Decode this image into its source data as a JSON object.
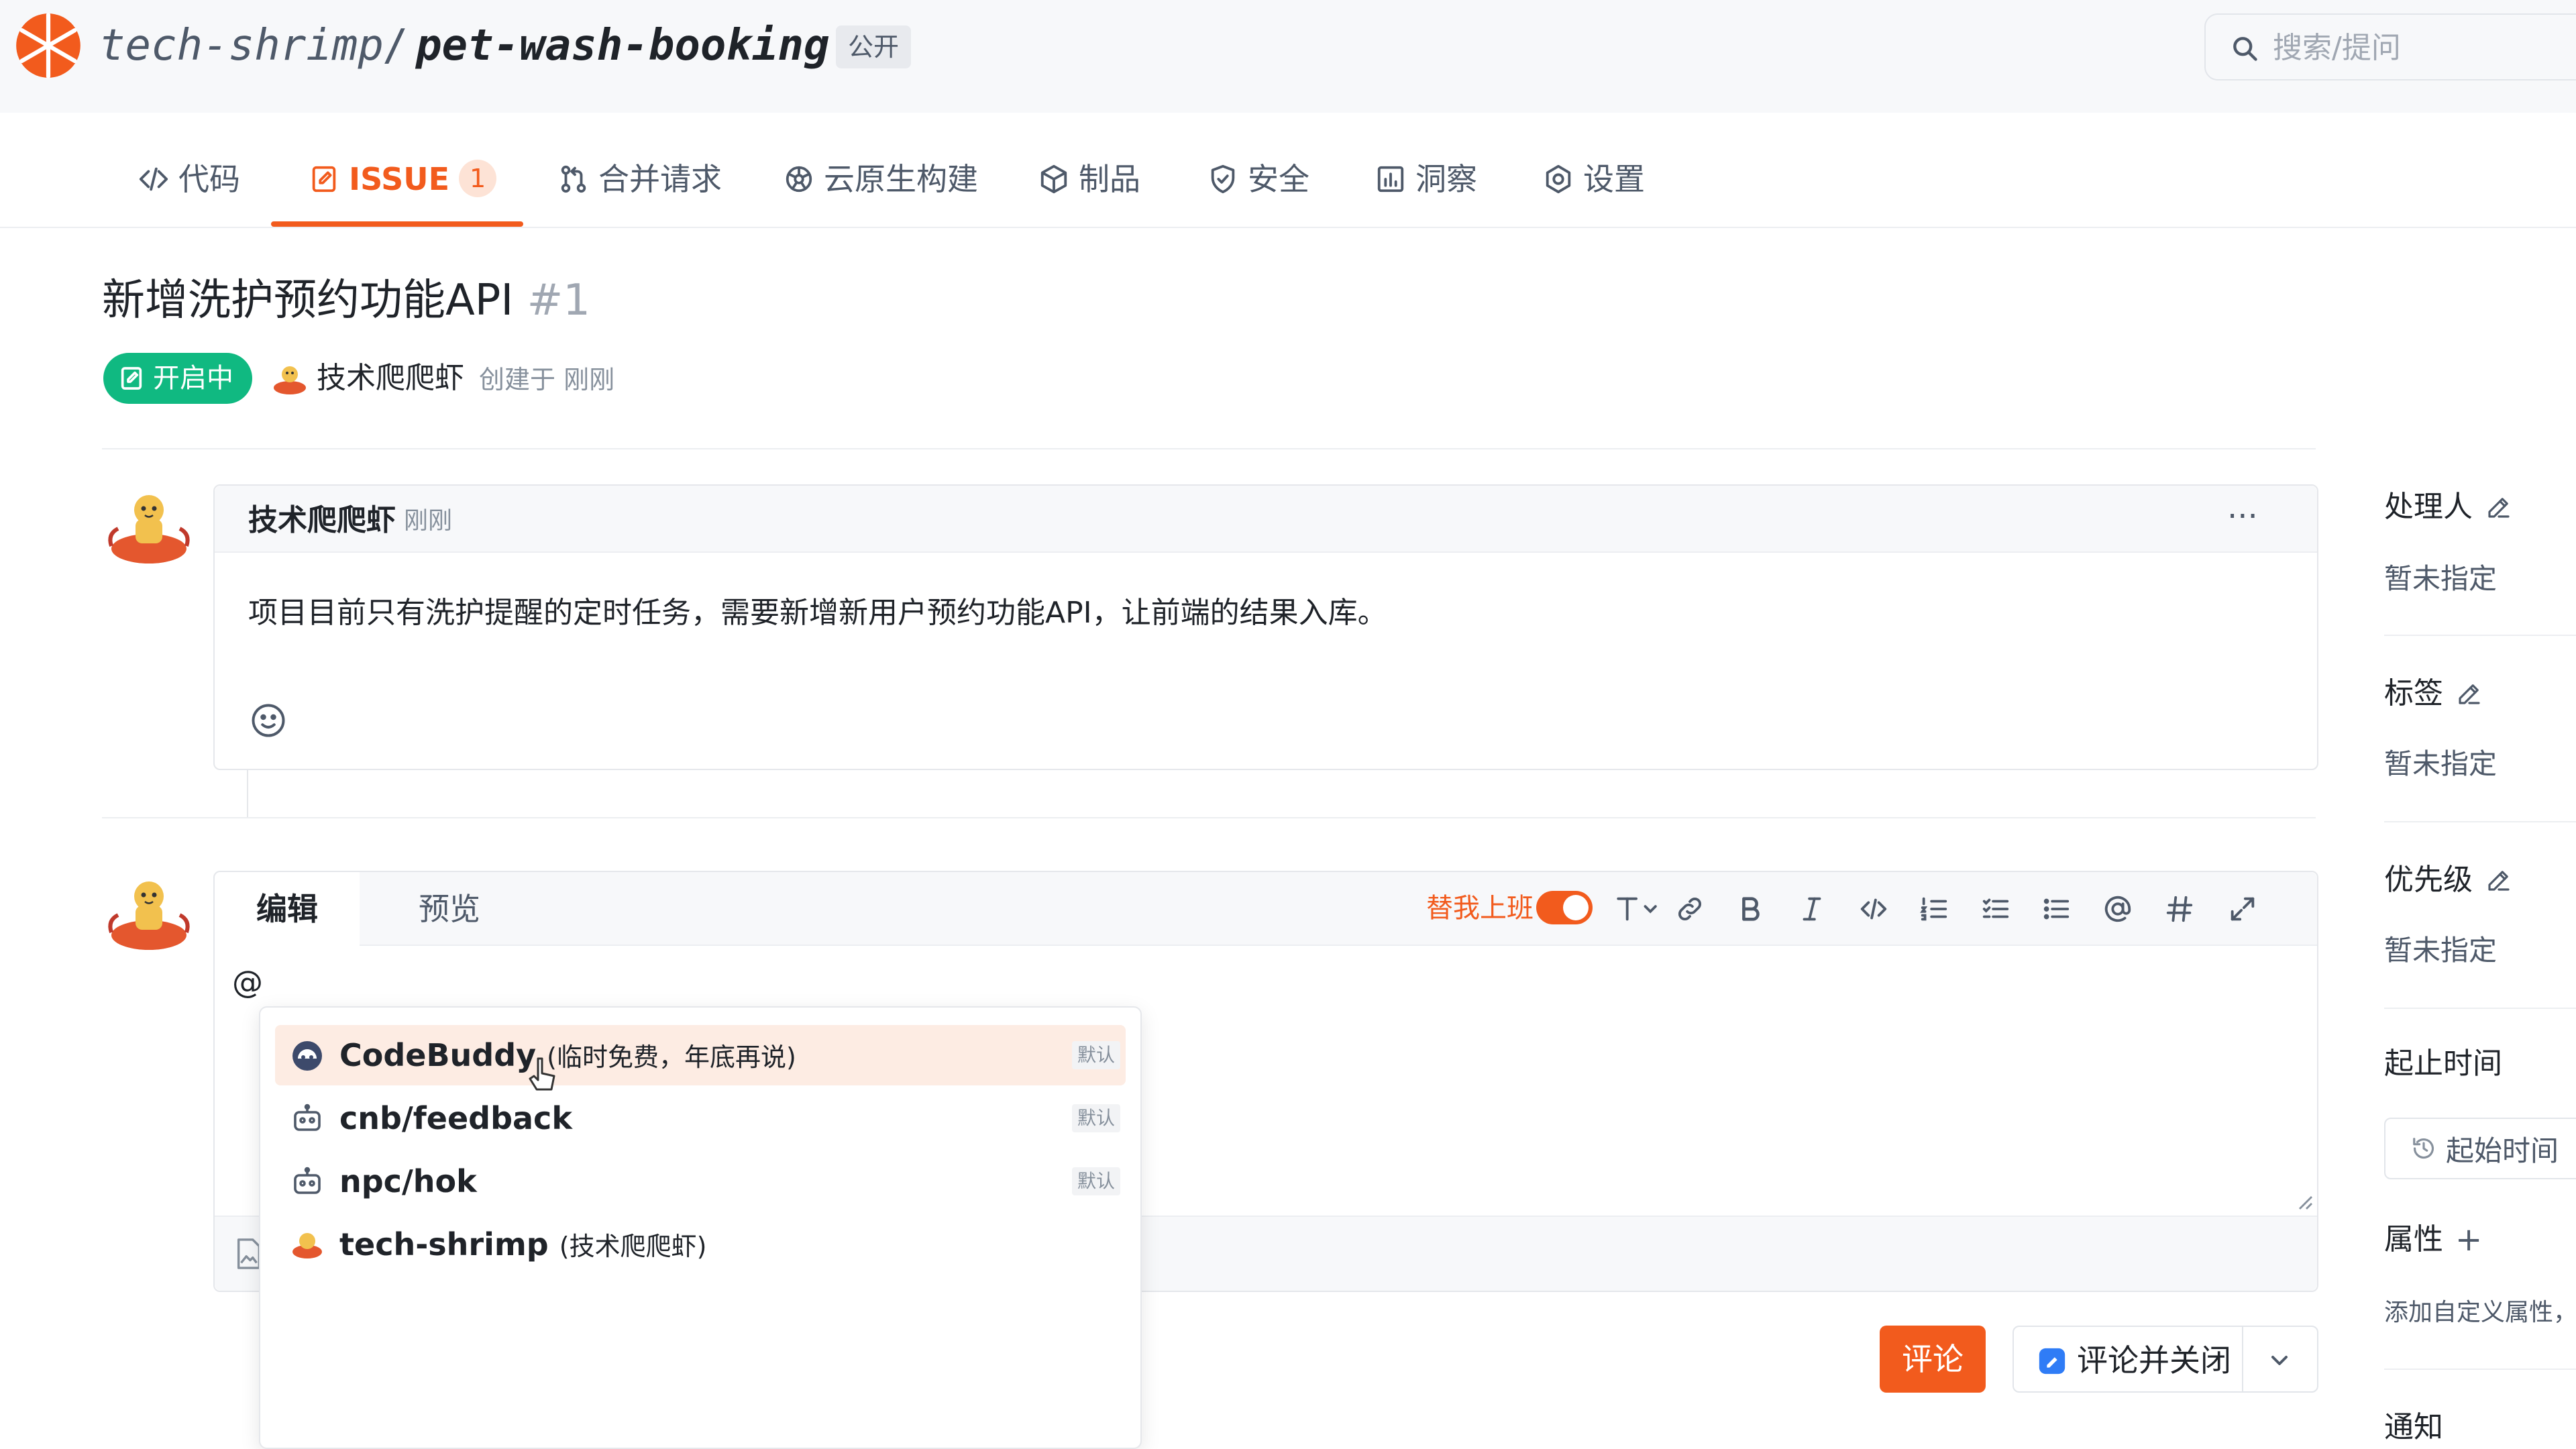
{
  "header": {
    "owner": "tech-shrimp",
    "slash": "/",
    "repo": "pet-wash-booking",
    "visibility": "公开",
    "search_placeholder": "搜索/提问"
  },
  "tabs": [
    {
      "label": "代码"
    },
    {
      "label": "ISSUE",
      "count": "1"
    },
    {
      "label": "合并请求"
    },
    {
      "label": "云原生构建"
    },
    {
      "label": "制品"
    },
    {
      "label": "安全"
    },
    {
      "label": "洞察"
    },
    {
      "label": "设置"
    }
  ],
  "issue": {
    "title": "新增洗护预约功能API",
    "number": "#1",
    "status": "开启中",
    "author": "技术爬爬虾",
    "created": "创建于 刚刚"
  },
  "comment": {
    "author": "技术爬爬虾",
    "time": "刚刚",
    "more": "···",
    "body": "项目目前只有洗护提醒的定时任务，需要新增新用户预约功能API，让前端的结果入库。"
  },
  "editor": {
    "tab_edit": "编辑",
    "tab_preview": "预览",
    "work_mode": "替我上班",
    "work_mode_on": true,
    "content": "@"
  },
  "mentions": [
    {
      "name": "CodeBuddy",
      "sub": "(临时免费，年底再说)",
      "badge": "默认"
    },
    {
      "name": "cnb/feedback",
      "sub": "",
      "badge": "默认"
    },
    {
      "name": "npc/hok",
      "sub": "",
      "badge": "默认"
    },
    {
      "name": "tech-shrimp",
      "sub": "(技术爬爬虾)",
      "badge": ""
    }
  ],
  "actions": {
    "comment": "评论",
    "comment_close": "评论并关闭"
  },
  "sidebar": {
    "assignee_label": "处理人",
    "assignee_value": "暂未指定",
    "labels_label": "标签",
    "labels_value": "暂未指定",
    "priority_label": "优先级",
    "priority_value": "暂未指定",
    "period_label": "起止时间",
    "start_time": "起始时间",
    "attributes_label": "属性",
    "attributes_add": "+",
    "attributes_note": "添加自定义属性，",
    "notify_label": "通知"
  },
  "colors": {
    "accent": "#f25b1d",
    "status_open": "#10b981"
  }
}
